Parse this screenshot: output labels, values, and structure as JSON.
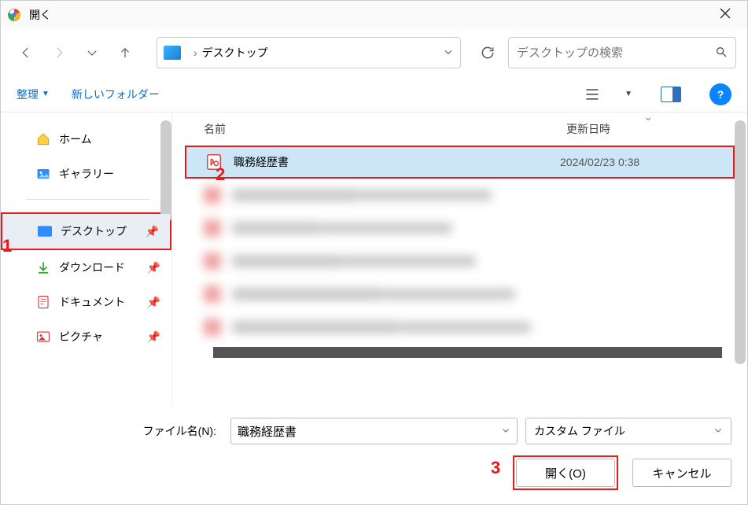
{
  "title": "開く",
  "breadcrumb": {
    "location": "デスクトップ"
  },
  "search": {
    "placeholder": "デスクトップの検索"
  },
  "toolbar": {
    "organize": "整理",
    "newfolder": "新しいフォルダー"
  },
  "sidebar": {
    "home": "ホーム",
    "gallery": "ギャラリー",
    "desktop": "デスクトップ",
    "downloads": "ダウンロード",
    "documents": "ドキュメント",
    "pictures": "ピクチャ"
  },
  "columns": {
    "name": "名前",
    "modified": "更新日時"
  },
  "file": {
    "name": "職務経歴書",
    "date": "2024/02/23 0:38"
  },
  "footer": {
    "filename_label": "ファイル名(N):",
    "filename_value": "職務経歴書",
    "filter": "カスタム ファイル",
    "open": "開く(O)",
    "cancel": "キャンセル"
  },
  "markers": {
    "m1": "1",
    "m2": "2",
    "m3": "3"
  }
}
